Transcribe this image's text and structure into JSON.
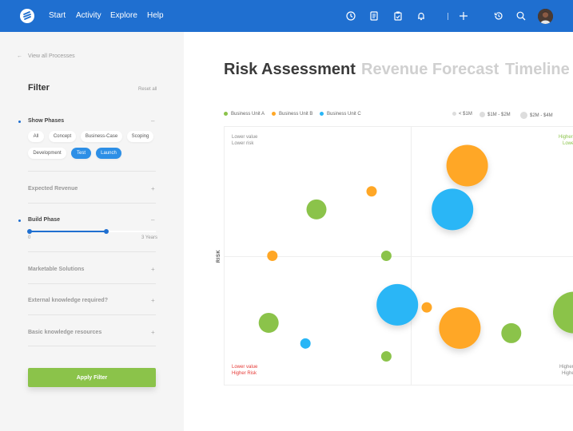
{
  "topbar": {
    "nav": [
      "Start",
      "Activity",
      "Explore",
      "Help"
    ],
    "icons": [
      "clock-icon",
      "document-icon",
      "clipboard-icon",
      "bell-icon",
      "plus-icon",
      "history-icon",
      "search-icon"
    ]
  },
  "sidebar": {
    "back_link": "View all Processes",
    "filter_title": "Filter",
    "reset_label": "Reset all",
    "show_phases": {
      "title": "Show Phases",
      "chips": [
        "All",
        "Concept",
        "Business-Case",
        "Scoping",
        "Development",
        "Test",
        "Launch"
      ],
      "active": [
        "Test",
        "Launch"
      ]
    },
    "expected_revenue": "Expected Revenue",
    "build_phase": {
      "title": "Build Phase",
      "min_label": "0",
      "max_label": "3 Years",
      "value_fraction": 0.6
    },
    "marketable_solutions": "Marketable Solutions",
    "external_knowledge": "External knowledge required?",
    "basic_knowledge": "Basic knowledge resources",
    "apply_label": "Apply Filter",
    "expand_sign": "+",
    "collapse_sign": "–"
  },
  "main": {
    "tabs": [
      "Risk Assessment",
      "Revenue Forecast",
      "Timeline"
    ],
    "active_tab": "Risk Assessment",
    "legend": [
      {
        "name": "Business Unit A",
        "color": "#8bc34a"
      },
      {
        "name": "Business Unit B",
        "color": "#ffa726"
      },
      {
        "name": "Business Unit C",
        "color": "#29b6f6"
      }
    ],
    "size_legend": [
      "< $1M",
      "$1M - $2M",
      "$2M - $4M"
    ],
    "quadrants": {
      "top_left": [
        "Lower value",
        "Lower risk"
      ],
      "top_right": [
        "Higher",
        "Lower"
      ],
      "bottom_left": [
        "Lower value",
        "Higher Risk"
      ],
      "bottom_right": [
        "Higher",
        "Higher"
      ]
    },
    "y_axis_label": "RISK"
  },
  "chart_data": {
    "type": "scatter",
    "ylabel": "RISK",
    "series": [
      {
        "name": "Business Unit A",
        "color": "#8bc34a",
        "points": [
          {
            "x": 0.12,
            "y": 0.24,
            "size": 2
          },
          {
            "x": 0.25,
            "y": 0.68,
            "size": 2
          },
          {
            "x": 0.44,
            "y": 0.11,
            "size": 1
          },
          {
            "x": 0.78,
            "y": 0.2,
            "size": 2
          },
          {
            "x": 0.44,
            "y": 0.5,
            "size": 1
          },
          {
            "x": 0.95,
            "y": 0.28,
            "size": 3
          }
        ]
      },
      {
        "name": "Business Unit B",
        "color": "#ffa726",
        "points": [
          {
            "x": 0.13,
            "y": 0.5,
            "size": 1
          },
          {
            "x": 0.4,
            "y": 0.75,
            "size": 1
          },
          {
            "x": 0.55,
            "y": 0.3,
            "size": 1
          },
          {
            "x": 0.66,
            "y": 0.85,
            "size": 3
          },
          {
            "x": 0.64,
            "y": 0.22,
            "size": 3
          }
        ]
      },
      {
        "name": "Business Unit C",
        "color": "#29b6f6",
        "points": [
          {
            "x": 0.22,
            "y": 0.16,
            "size": 1
          },
          {
            "x": 0.47,
            "y": 0.31,
            "size": 3
          },
          {
            "x": 0.62,
            "y": 0.68,
            "size": 3
          }
        ]
      }
    ]
  }
}
